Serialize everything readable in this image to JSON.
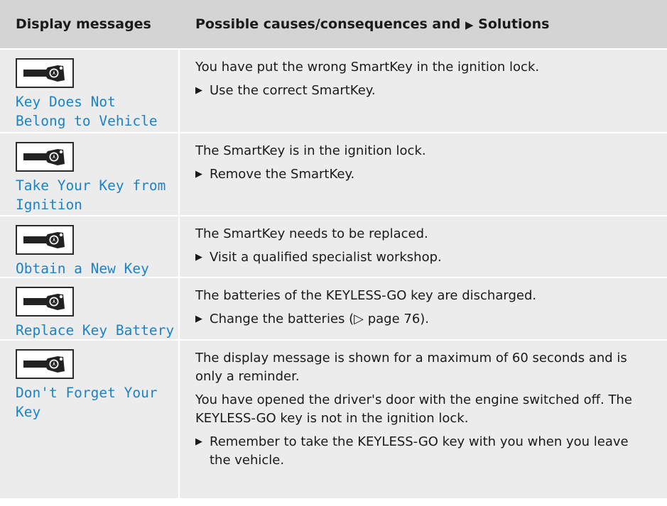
{
  "header": {
    "col1": "Display messages",
    "col2_pre": "Possible causes/consequences and ",
    "col2_arrow": "▶",
    "col2_post": " Solutions"
  },
  "icon": "smartkey-icon",
  "rows": [
    {
      "message": "Key Does Not\nBelong to Vehicle",
      "paragraphs": [
        "You have put the wrong SmartKey in the ignition lock."
      ],
      "actions": [
        "Use the correct SmartKey."
      ]
    },
    {
      "message": "Take Your Key from\nIgnition",
      "paragraphs": [
        "The SmartKey is in the ignition lock."
      ],
      "actions": [
        "Remove the SmartKey."
      ]
    },
    {
      "message": "Obtain a New Key",
      "paragraphs": [
        "The SmartKey needs to be replaced."
      ],
      "actions": [
        "Visit a qualified specialist workshop."
      ]
    },
    {
      "message": "Replace Key Battery",
      "paragraphs": [
        "The batteries of the KEYLESS-GO key are discharged."
      ],
      "actions": [
        "Change the batteries (▷ page 76)."
      ]
    },
    {
      "message": "Don't Forget Your\nKey",
      "paragraphs": [
        "The display message is shown for a maximum of 60 seconds and is only a reminder.",
        "You have opened the driver's door with the engine switched off. The KEYLESS-GO key is not in the ignition lock."
      ],
      "actions": [
        "Remember to take the KEYLESS-GO key with you when you leave the vehicle."
      ]
    }
  ],
  "colors": {
    "header_bg": "#d4d4d4",
    "row_bg": "#ececec",
    "message_text": "#1a84c6"
  }
}
